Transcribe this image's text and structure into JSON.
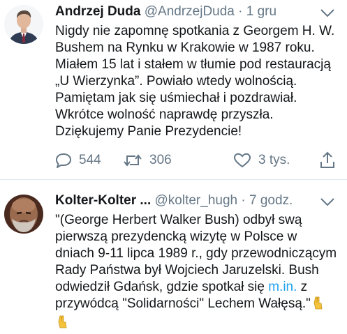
{
  "tweets": [
    {
      "display_name": "Andrzej Duda",
      "handle": "@AndrzejDuda",
      "separator": "·",
      "time": "1 gru",
      "text": "Nigdy nie zapomnę spotkania z Georgem H. W. Bushem na Rynku w Krakowie w 1987 roku. Miałem 15 lat i stałem w tłumie pod restauracją „U Wierzynka”. Powiało wtedy wolnością. Pamiętam jak się uśmiechał i pozdrawiał. Wkrótce wolność naprawdę przyszła. Dziękujemy Panie Prezydencie!",
      "reply_count": "544",
      "retweet_count": "306",
      "like_count": "3 tys."
    },
    {
      "display_name": "Kolter-Kolter ...",
      "handle": "@kolter_hugh",
      "separator": "·",
      "time": "7 godz.",
      "text_part1": "\"(George Herbert Walker Bush) odbył swą pierwszą prezydencką wizytę w Polsce w dniach 9-11 lipca 1989 r., gdy przewodniczącym Rady Państwa był Wojciech Jaruzelski. Bush odwiedził Gdańsk, gdzie spotkał się ",
      "link_text": "m.in.",
      "text_part2": " z przywódcą \"Solidarności\" Lechem Wałęsą.\"",
      "emoji": "victory-hand-emoji"
    }
  ],
  "colors": {
    "text": "#14171a",
    "meta": "#657786",
    "link": "#1da1f2",
    "divider": "#e1e8ed",
    "emoji": "#f5c33b"
  },
  "icons": [
    "chevron-down-icon",
    "reply-icon",
    "retweet-icon",
    "like-icon",
    "share-icon"
  ]
}
